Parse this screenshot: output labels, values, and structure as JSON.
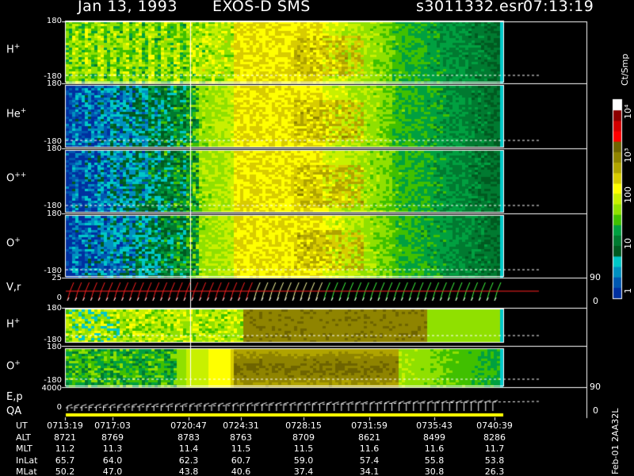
{
  "header": {
    "date": "Jan 13, 1993",
    "instrument": "EXOS-D SMS",
    "file": "s3011332.esr",
    "time": "07:13:19"
  },
  "footer_left": "Feb-01 2AA32L",
  "colorbar": {
    "unit": "Ct/Smp",
    "labels": [
      "10⁴",
      "10³",
      "100",
      "10",
      "1"
    ],
    "colors": [
      "#ffffff",
      "#8b0000",
      "#d40000",
      "#ff0000",
      "#6e6400",
      "#8f8400",
      "#b0a400",
      "#d8cc00",
      "#ffff00",
      "#c8f000",
      "#90e000",
      "#40c000",
      "#00a040",
      "#007a30",
      "#005a20",
      "#00c8c8",
      "#0090c0",
      "#0058b0",
      "#0030a0"
    ]
  },
  "chart_data": {
    "type": "heatmap",
    "title": "Jan 13, 1993   EXOS-D SMS",
    "x_axis": {
      "quantity": "UT",
      "tick_labels": [
        "0713:19",
        "0717:03",
        "0720:47",
        "0724:31",
        "0728:15",
        "0731:59",
        "0735:43",
        "0740:39"
      ]
    },
    "panels": [
      {
        "label": "H",
        "superscript": "+",
        "y_top": "180",
        "y_bottom": "-180"
      },
      {
        "label": "He",
        "superscript": "+",
        "y_top": "180",
        "y_bottom": "-180"
      },
      {
        "label": "O",
        "superscript": "++",
        "y_top": "180",
        "y_bottom": "-180"
      },
      {
        "label": "O",
        "superscript": "+",
        "y_top": "180",
        "y_bottom": "-180"
      },
      {
        "label": "V,r",
        "superscript": "",
        "y_top": "25",
        "y_bottom": "0",
        "right_top": "90",
        "right_bottom": "0"
      },
      {
        "label": "H",
        "superscript": "+",
        "y_top": "180",
        "y_bottom": "-180"
      },
      {
        "label": "O",
        "superscript": "+",
        "y_top": "180",
        "y_bottom": "-180"
      },
      {
        "label": "E,p",
        "label2": "QA",
        "superscript": "",
        "y_top": "4000",
        "y_bottom": "0",
        "right_top": "90",
        "right_bottom": "0"
      }
    ],
    "colorbar_range": [
      1,
      10000
    ],
    "colorbar_scale": "log",
    "ephemeris": [
      {
        "name": "UT",
        "values": [
          "0713:19",
          "0717:03",
          "0720:47",
          "0724:31",
          "0728:15",
          "0731:59",
          "0735:43",
          "0740:39"
        ]
      },
      {
        "name": "ALT",
        "values": [
          "8721",
          "8769",
          "8783",
          "8763",
          "8709",
          "8621",
          "8499",
          "8286"
        ]
      },
      {
        "name": "MLT",
        "values": [
          "11.2",
          "11.3",
          "11.4",
          "11.5",
          "11.5",
          "11.6",
          "11.6",
          "11.7"
        ]
      },
      {
        "name": "InLat",
        "values": [
          "65.7",
          "64.0",
          "62.3",
          "60.7",
          "59.0",
          "57.4",
          "55.8",
          "53.8"
        ]
      },
      {
        "name": "MLat",
        "values": [
          "50.2",
          "47.0",
          "43.8",
          "40.6",
          "37.4",
          "34.1",
          "30.8",
          "26.3"
        ]
      }
    ]
  }
}
